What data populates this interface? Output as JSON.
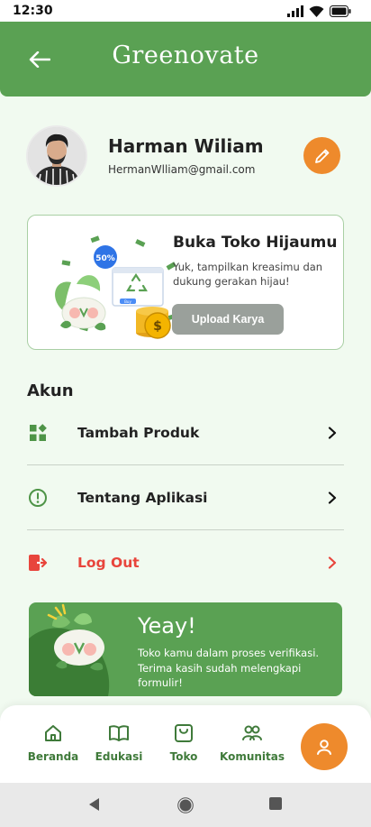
{
  "status_bar": {
    "time": "12:30"
  },
  "header": {
    "brand": "Greenovate"
  },
  "profile": {
    "name": "Harman Wiliam",
    "email": "HermanWlliam@gmail.com"
  },
  "promo": {
    "title": "Buka Toko Hijaumu",
    "description": "Yuk, tampilkan kreasimu dan dukung gerakan hijau!",
    "button_label": "Upload Karya",
    "badge_text": "50%",
    "screen_button_text": "Buy"
  },
  "account_section": {
    "title": "Akun",
    "items": [
      {
        "label": "Tambah Produk",
        "icon": "grid-plus-icon",
        "color": "#222222"
      },
      {
        "label": "Tentang Aplikasi",
        "icon": "info-circle-icon",
        "color": "#222222"
      },
      {
        "label": "Log Out",
        "icon": "logout-icon",
        "color": "#e8453c"
      }
    ]
  },
  "verification": {
    "title": "Yeay!",
    "message": "Toko kamu dalam proses verifikasi. Terima kasih sudah melengkapi formulir!"
  },
  "bottom_nav": {
    "items": [
      {
        "label": "Beranda",
        "icon": "home-icon"
      },
      {
        "label": "Edukasi",
        "icon": "book-icon"
      },
      {
        "label": "Toko",
        "icon": "shop-icon"
      },
      {
        "label": "Komunitas",
        "icon": "community-icon"
      }
    ],
    "active": "profile-icon"
  },
  "colors": {
    "primary": "#5aa153",
    "accent": "#ee8a2c",
    "danger": "#e8453c",
    "background": "#f1faf0"
  }
}
